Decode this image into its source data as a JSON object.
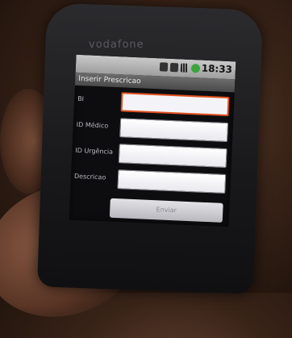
{
  "status_bar": {
    "time": "18:33"
  },
  "app": {
    "title": "Inserir Prescricao"
  },
  "form": {
    "fields": [
      {
        "label": "BI",
        "value": "",
        "focused": true
      },
      {
        "label": "ID Médico",
        "value": ""
      },
      {
        "label": "ID Urgência",
        "value": ""
      },
      {
        "label": "Descricao",
        "value": ""
      }
    ],
    "submit_label": "Enviar"
  },
  "colors": {
    "focus_border": "#e05020",
    "title_bar": "#4a4a4a",
    "status_bar": "#b0b0b0"
  }
}
